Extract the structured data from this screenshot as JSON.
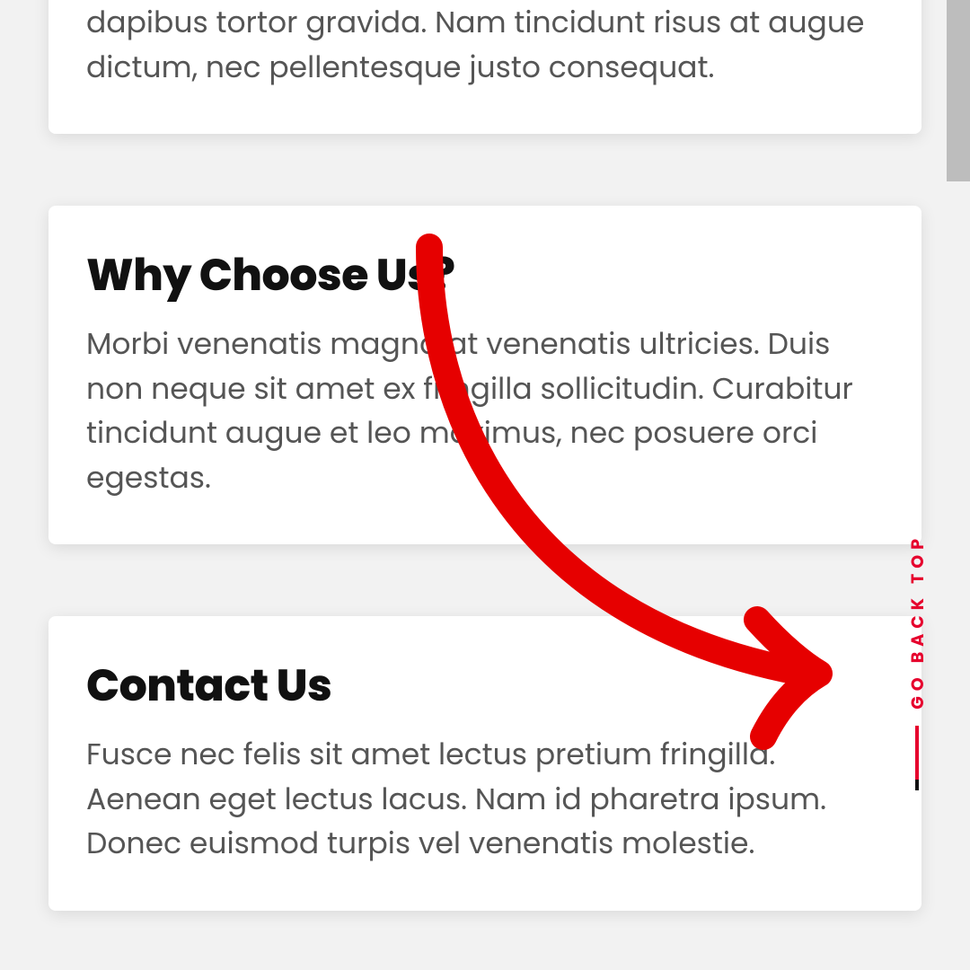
{
  "cards": [
    {
      "title": "",
      "body": "dapibus tortor gravida. Nam tincidunt risus at augue dictum, nec pellentesque justo consequat."
    },
    {
      "title": "Why Choose Us?",
      "body": "Morbi venenatis magna at venenatis ultricies. Duis non neque sit amet ex fringilla sollicitudin. Curabitur tincidunt augue et leo maximus, nec posuere orci egestas."
    },
    {
      "title": "Contact Us",
      "body": "Fusce nec felis sit amet lectus pretium fringilla. Aenean eget lectus lacus. Nam id pharetra ipsum. Donec euismod turpis vel venenatis molestie."
    }
  ],
  "goBackTop": {
    "label": "GO BACK TOP"
  },
  "colors": {
    "accent": "#e6002d",
    "cardBg": "#ffffff",
    "pageBg": "#f2f2f2",
    "text": "#555",
    "heading": "#111"
  }
}
